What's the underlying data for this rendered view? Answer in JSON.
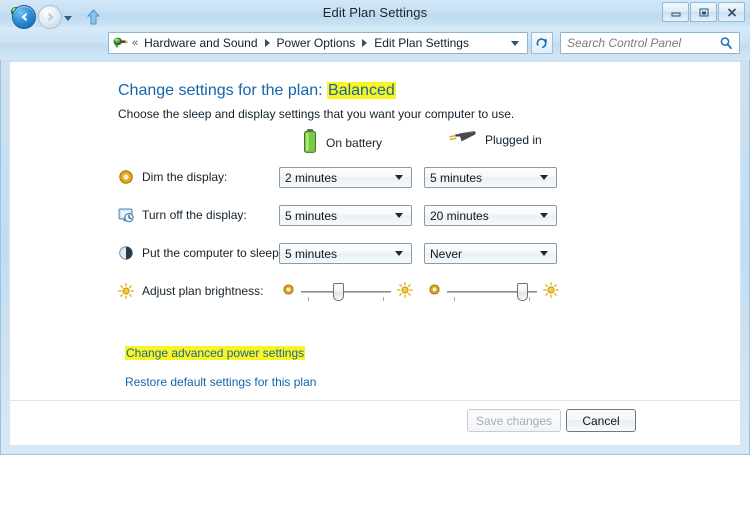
{
  "window": {
    "title": "Edit Plan Settings",
    "icon": "power-plug-icon",
    "controls": {
      "minimize": "Minimize",
      "maximize": "Restore Down",
      "close": "Close"
    }
  },
  "nav": {
    "back": "Back",
    "forward": "Forward",
    "recent_pages": "Recent Pages",
    "up": "Up one level",
    "refresh": "Refresh",
    "breadcrumb_overflow": "«",
    "breadcrumbs": [
      {
        "label": "Hardware and Sound"
      },
      {
        "label": "Power Options"
      },
      {
        "label": "Edit Plan Settings"
      }
    ]
  },
  "search": {
    "placeholder": "Search Control Panel",
    "value": "",
    "icon": "search-icon"
  },
  "main": {
    "heading_prefix": "Change settings for the plan:",
    "heading_plan": "Balanced",
    "subheading": "Choose the sleep and display settings that you want your computer to use.",
    "columns": [
      {
        "label": "On battery",
        "icon": "battery-icon"
      },
      {
        "label": "Plugged in",
        "icon": "power-plug-icon"
      }
    ],
    "settings": [
      {
        "icon": "dim-display-icon",
        "label": "Dim the display:",
        "on_battery": "2 minutes",
        "plugged_in": "5 minutes"
      },
      {
        "icon": "turn-off-display-icon",
        "label": "Turn off the display:",
        "on_battery": "5 minutes",
        "plugged_in": "20 minutes"
      },
      {
        "icon": "sleep-icon",
        "label": "Put the computer to sleep:",
        "on_battery": "5 minutes",
        "plugged_in": "Never"
      }
    ],
    "brightness": {
      "icon": "brightness-icon",
      "label": "Adjust plan brightness:",
      "on_battery_percent": 40,
      "plugged_in_percent": 88,
      "low_icon": "brightness-low-icon",
      "high_icon": "brightness-high-icon"
    },
    "links": [
      {
        "label": "Change advanced power settings",
        "highlighted": true
      },
      {
        "label": "Restore default settings for this plan",
        "highlighted": false
      }
    ]
  },
  "footer": {
    "save_label": "Save changes",
    "save_enabled": false,
    "cancel_label": "Cancel"
  },
  "colors": {
    "link": "#1465ab",
    "highlight": "#fbf51f",
    "title_bar": "#c6dff2",
    "battery_green": "#6fbf3a"
  }
}
